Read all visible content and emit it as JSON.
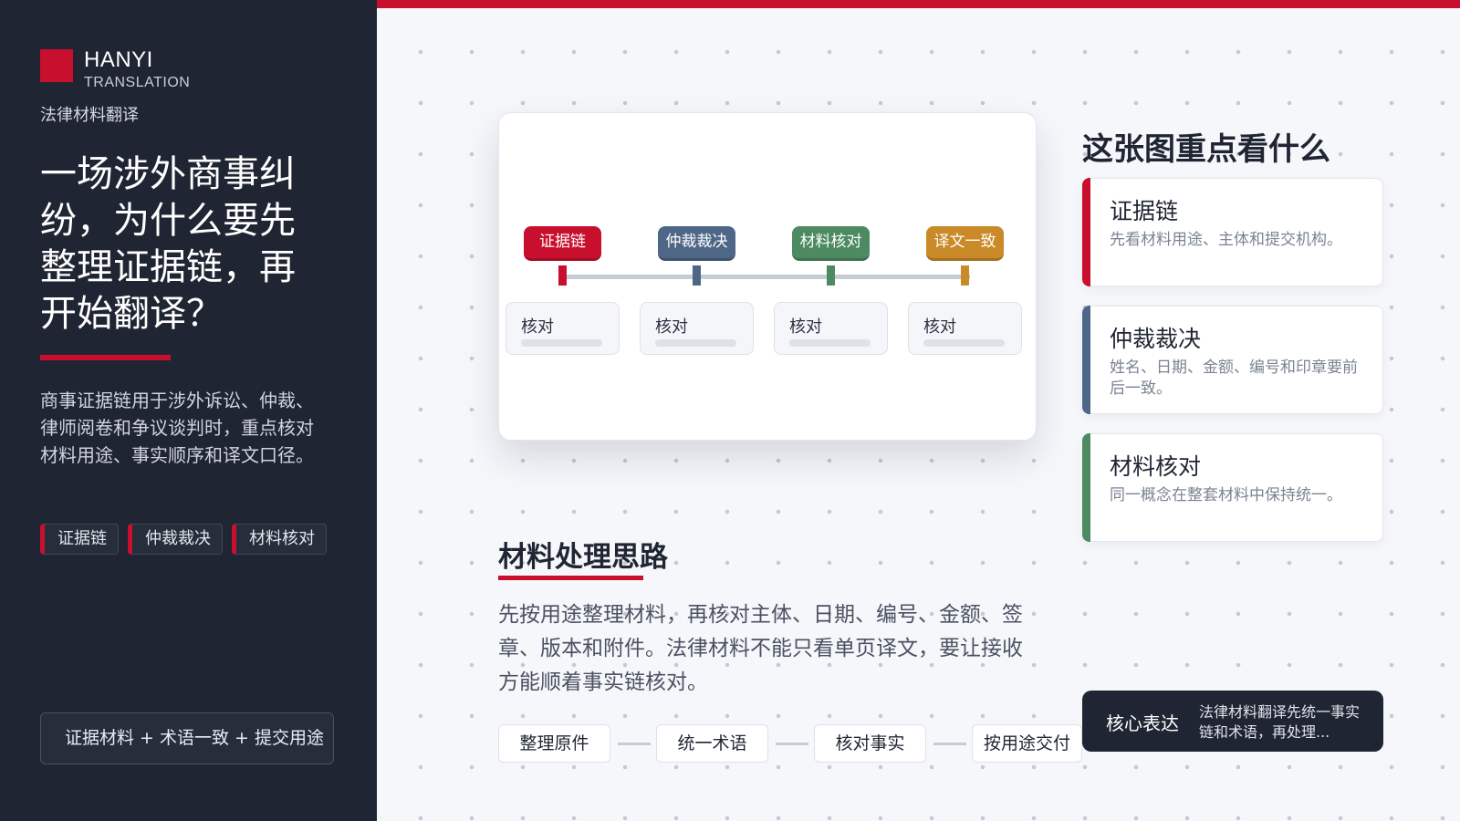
{
  "brand": {
    "name": "HANYI",
    "sub": "TRANSLATION",
    "tagline": "法律材料翻译"
  },
  "sidebar": {
    "headline": "一场涉外商事纠纷，为什么要先整理证据链，再开始翻译？",
    "intro": "商事证据链用于涉外诉讼、仲裁、律师阅卷和争议谈判时，重点核对材料用途、事实顺序和译文口径。",
    "tags": [
      "证据链",
      "仲裁裁决",
      "材料核对"
    ],
    "formula": "证据材料 + 术语一致 + 提交用途"
  },
  "diagram": {
    "steps": [
      {
        "label": "证据链",
        "color": "#c8102e",
        "box_label": "核对"
      },
      {
        "label": "仲裁裁决",
        "color": "#4e6787",
        "box_label": "核对"
      },
      {
        "label": "材料核对",
        "color": "#4d8a62",
        "box_label": "核对"
      },
      {
        "label": "译文一致",
        "color": "#c98a27",
        "box_label": "核对"
      }
    ]
  },
  "process": {
    "title": "材料处理思路",
    "body": "先按用途整理材料，再核对主体、日期、编号、金额、签章、版本和附件。法律材料不能只看单页译文，要让接收方能顺着事实链核对。",
    "flow": [
      "整理原件",
      "统一术语",
      "核对事实",
      "按用途交付"
    ]
  },
  "panel": {
    "title": "这张图重点看什么",
    "cards": [
      {
        "title": "证据链",
        "desc": "先看材料用途、主体和提交机构。",
        "color": "#c8102e"
      },
      {
        "title": "仲裁裁决",
        "desc": "姓名、日期、金额、编号和印章要前后一致。",
        "color": "#4e6787"
      },
      {
        "title": "材料核对",
        "desc": "同一概念在整套材料中保持统一。",
        "color": "#4d8a62"
      }
    ]
  },
  "core": {
    "label": "核心表达",
    "text": "法律材料翻译先统一事实链和术语，再处理..."
  }
}
